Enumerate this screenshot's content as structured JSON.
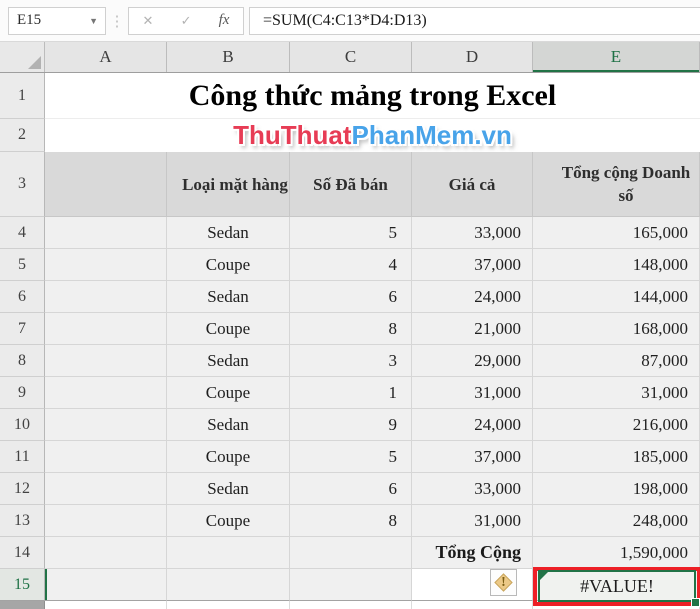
{
  "formula_bar": {
    "name_box_value": "E15",
    "dropdown_icon": "▼",
    "cancel_icon": "✕",
    "enter_icon": "✓",
    "fx_icon": "fx",
    "formula": "=SUM(C4:C13*D4:D13)"
  },
  "columns": [
    "A",
    "B",
    "C",
    "D",
    "E"
  ],
  "selected_column": "E",
  "title_row": {
    "num": "1",
    "title": "Công thức mảng trong Excel"
  },
  "watermark_row": {
    "num": "2",
    "part_red": "ThuThuat",
    "part_blue": "PhanMem.vn"
  },
  "header_row": {
    "num": "3",
    "item_type": "Loại mặt hàng",
    "sold": "Số Đã bán",
    "price": "Giá cả",
    "total": "Tổng cộng Doanh số"
  },
  "rows": [
    {
      "num": "4",
      "type": "Sedan",
      "qty": "5",
      "price": "33,000",
      "total": "165,000"
    },
    {
      "num": "5",
      "type": "Coupe",
      "qty": "4",
      "price": "37,000",
      "total": "148,000"
    },
    {
      "num": "6",
      "type": "Sedan",
      "qty": "6",
      "price": "24,000",
      "total": "144,000"
    },
    {
      "num": "7",
      "type": "Coupe",
      "qty": "8",
      "price": "21,000",
      "total": "168,000"
    },
    {
      "num": "8",
      "type": "Sedan",
      "qty": "3",
      "price": "29,000",
      "total": "87,000"
    },
    {
      "num": "9",
      "type": "Coupe",
      "qty": "1",
      "price": "31,000",
      "total": "31,000"
    },
    {
      "num": "10",
      "type": "Sedan",
      "qty": "9",
      "price": "24,000",
      "total": "216,000"
    },
    {
      "num": "11",
      "type": "Coupe",
      "qty": "5",
      "price": "37,000",
      "total": "185,000"
    },
    {
      "num": "12",
      "type": "Sedan",
      "qty": "6",
      "price": "33,000",
      "total": "198,000"
    },
    {
      "num": "13",
      "type": "Coupe",
      "qty": "8",
      "price": "31,000",
      "total": "248,000"
    }
  ],
  "total_row": {
    "num": "14",
    "label": "Tổng Cộng",
    "value": "1,590,000"
  },
  "error_row": {
    "num": "15",
    "warning_icon": "!",
    "value": "#VALUE!"
  },
  "colors": {
    "accent_green": "#217346",
    "annotation_red": "#ed1f26",
    "watermark_red": "#e73c55",
    "watermark_blue": "#48a3e9",
    "header_fill": "#d9d9d9",
    "data_fill": "#f0f0f0"
  }
}
